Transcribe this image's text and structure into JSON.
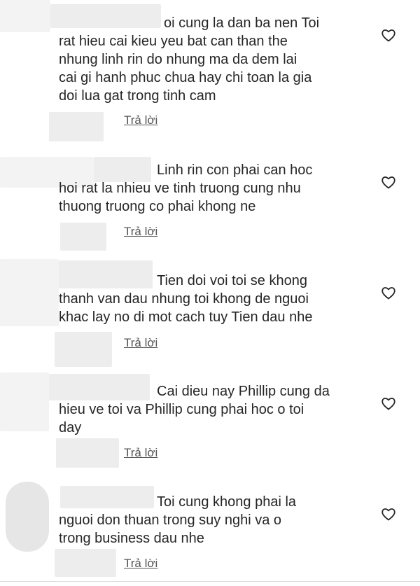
{
  "comments": [
    {
      "text": "oi cung la dan ba nen Toi rat hieu cai kieu yeu bat can than the nhung linh rin do nhung ma da dem lai cai gi hanh phuc chua hay chi toan la gia doi lua gat trong tinh cam",
      "reply_label": "Trả lời",
      "icon": "heart-outline-icon"
    },
    {
      "text": "Linh rin con phai can hoc hoi rat la nhieu ve tinh truong cung nhu thuong truong co phai khong ne",
      "reply_label": "Trả lời",
      "icon": "heart-outline-icon"
    },
    {
      "text": "Tien doi voi toi se khong thanh van dau nhung toi khong de nguoi khac lay no di mot cach tuy Tien dau nhe",
      "reply_label": "Trả lời",
      "icon": "heart-outline-icon"
    },
    {
      "text": "Cai dieu nay Phillip cung da hieu ve toi va Phillip cung phai hoc o toi day",
      "reply_label": "Trả lời",
      "icon": "heart-outline-icon"
    },
    {
      "text": "Toi cung khong phai la nguoi don thuan trong suy nghi va o trong business dau nhe",
      "reply_label": "Trả lời",
      "icon": "heart-outline-icon"
    }
  ],
  "colors": {
    "text": "#262626",
    "reply": "#555555",
    "redaction": "#ededed",
    "heart_stroke": "#262626"
  }
}
